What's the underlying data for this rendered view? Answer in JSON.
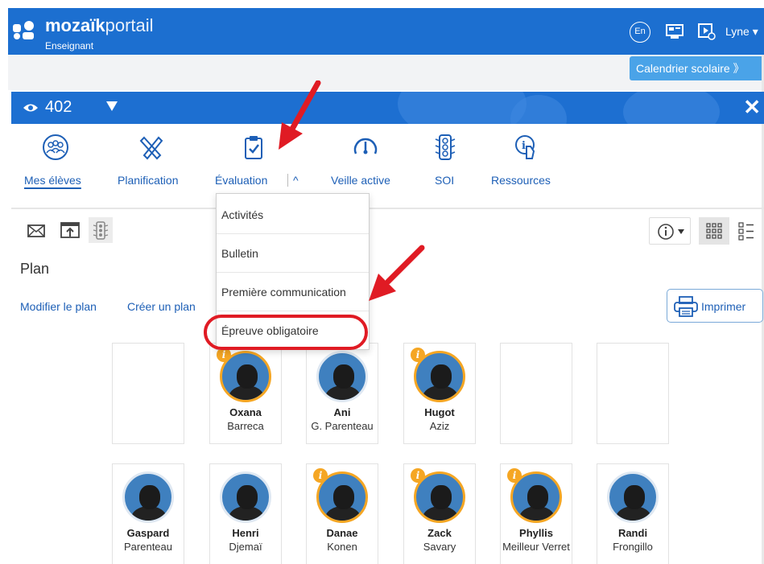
{
  "header": {
    "brand_bold": "mozaïk",
    "brand_light": "portail",
    "role": "Enseignant",
    "lang": "En",
    "user": "Lyne ▾",
    "calendar": "Calendrier scolaire 》"
  },
  "group": {
    "number": "402"
  },
  "nav": {
    "items": [
      {
        "label": "Mes élèves",
        "icon": "students-icon"
      },
      {
        "label": "Planification",
        "icon": "pencil-ruler-icon"
      },
      {
        "label": "Évaluation",
        "icon": "clipboard-check-icon"
      },
      {
        "label": "Veille active",
        "icon": "gauge-icon"
      },
      {
        "label": "SOI",
        "icon": "traffic-light-icon"
      },
      {
        "label": "Ressources",
        "icon": "info-hand-icon"
      }
    ],
    "eval_caret": "^"
  },
  "menu": {
    "items": [
      "Activités",
      "Bulletin",
      "Première communication",
      "Épreuve obligatoire"
    ]
  },
  "page": {
    "title": "Plan",
    "modify": "Modifier le plan",
    "create": "Créer un plan",
    "print": "Imprimer"
  },
  "students": [
    {
      "first": "Oxana",
      "last": "Barreca",
      "alert": true
    },
    {
      "first": "Ani",
      "last": "G. Parenteau",
      "alert": false
    },
    {
      "first": "Hugot",
      "last": "Aziz",
      "alert": true
    },
    {
      "first": "Gaspard",
      "last": "Parenteau",
      "alert": false
    },
    {
      "first": "Henri",
      "last": "Djemaï",
      "alert": false
    },
    {
      "first": "Danae",
      "last": "Konen",
      "alert": true
    },
    {
      "first": "Zack",
      "last": "Savary",
      "alert": true
    },
    {
      "first": "Phyllis",
      "last": "Meilleur Verret",
      "alert": true
    },
    {
      "first": "Randi",
      "last": "Frongillo",
      "alert": false
    }
  ],
  "badge": "i",
  "colors": {
    "brand": "#1c6fd0",
    "link": "#1d5fb6",
    "alert": "#f5a623",
    "annotation": "#e01b24"
  }
}
